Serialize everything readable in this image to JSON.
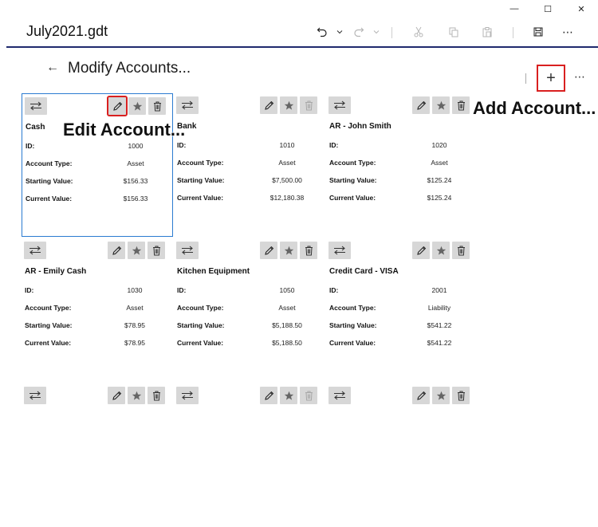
{
  "window": {
    "minimize_glyph": "—",
    "maximize_glyph": "☐",
    "close_glyph": "✕"
  },
  "app": {
    "document_title": "July2021.gdt",
    "commands": [
      "undo-icon",
      "dropdown-icon",
      "redo-icon",
      "dropdown-icon",
      "cut-icon",
      "copy-icon",
      "paste-icon",
      "save-icon",
      "more-icon"
    ],
    "more_glyph": "⋯"
  },
  "page": {
    "back_glyph": "←",
    "title": "Modify Accounts...",
    "add_glyph": "+",
    "more_glyph": "⋯"
  },
  "annotations": {
    "edit": "Edit Account...",
    "add": "Add Account..."
  },
  "labels": {
    "id": "ID:",
    "type": "Account Type:",
    "start": "Starting Value:",
    "current": "Current Value:"
  },
  "accounts": [
    {
      "name": "Cash",
      "id": "1000",
      "type": "Asset",
      "starting": "$156.33",
      "current": "$156.33",
      "selected": true
    },
    {
      "name": "Bank",
      "id": "1010",
      "type": "Asset",
      "starting": "$7,500.00",
      "current": "$12,180.38"
    },
    {
      "name": "AR - John Smith",
      "id": "1020",
      "type": "Asset",
      "starting": "$125.24",
      "current": "$125.24"
    },
    {
      "name": "AR - Emily Cash",
      "id": "1030",
      "type": "Asset",
      "starting": "$78.95",
      "current": "$78.95"
    },
    {
      "name": "Kitchen Equipment",
      "id": "1050",
      "type": "Asset",
      "starting": "$5,188.50",
      "current": "$5,188.50"
    },
    {
      "name": "Credit Card - VISA",
      "id": "2001",
      "type": "Liability",
      "starting": "$541.22",
      "current": "$541.22"
    }
  ],
  "colors": {
    "selection": "#2b7bd1",
    "highlight": "#d92020",
    "accent_line": "#1f2a6e",
    "button_bg": "#d7d7d7"
  }
}
